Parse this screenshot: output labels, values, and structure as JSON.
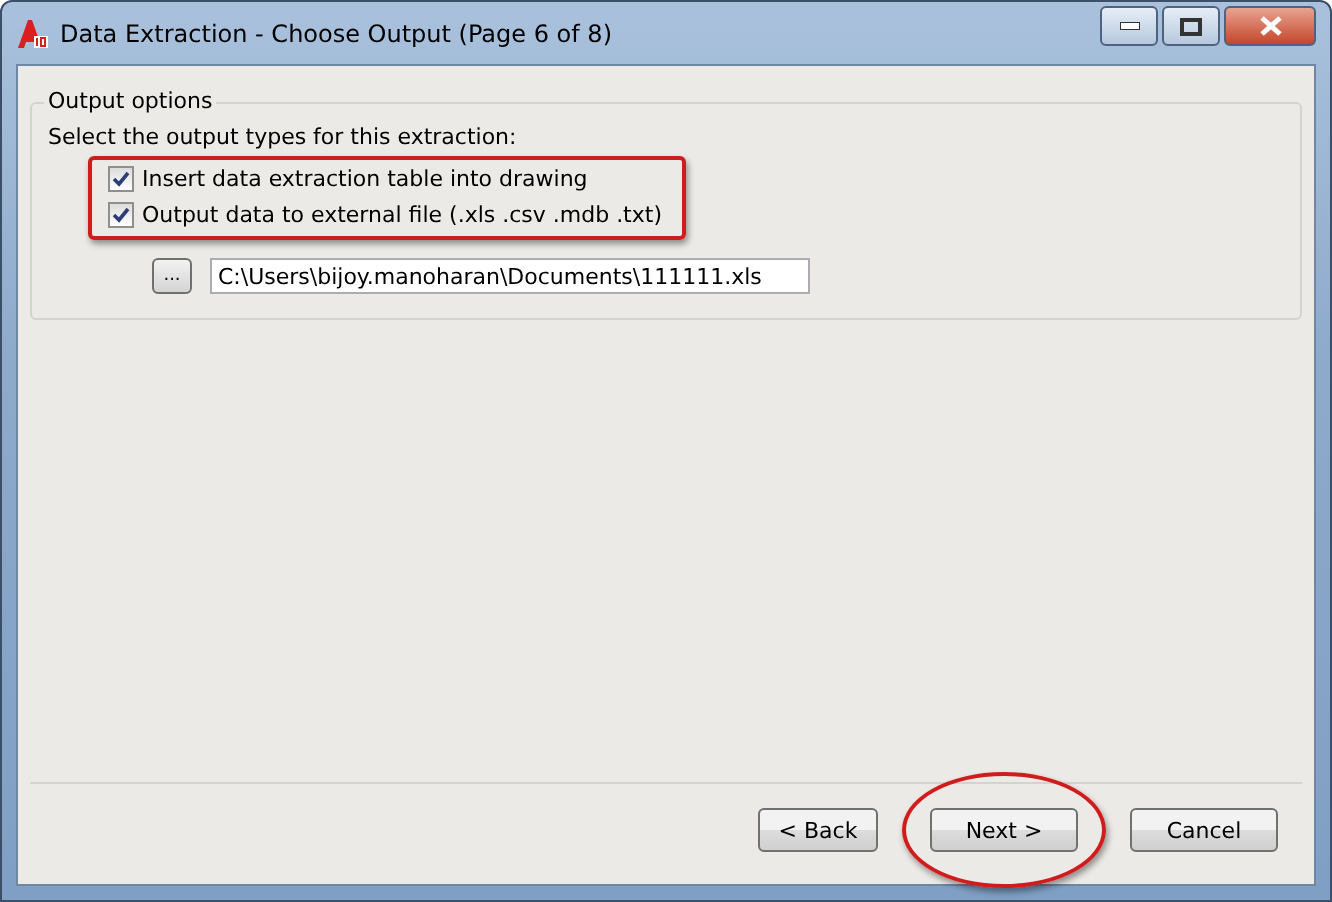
{
  "window": {
    "title": "Data Extraction - Choose Output (Page 6 of 8)"
  },
  "output_options": {
    "title": "Output options",
    "prompt": "Select the output types for this extraction:",
    "options": [
      {
        "label": "Insert data extraction table into drawing",
        "checked": true
      },
      {
        "label": "Output data to external file (.xls .csv .mdb .txt)",
        "checked": true
      }
    ],
    "browse_button": "...",
    "file_path": "C:\\Users\\bijoy.manoharan\\Documents\\111111.xls"
  },
  "buttons": [
    {
      "label": "< Back",
      "highlighted": false
    },
    {
      "label": "Next >",
      "highlighted": true
    },
    {
      "label": "Cancel",
      "highlighted": false
    }
  ]
}
